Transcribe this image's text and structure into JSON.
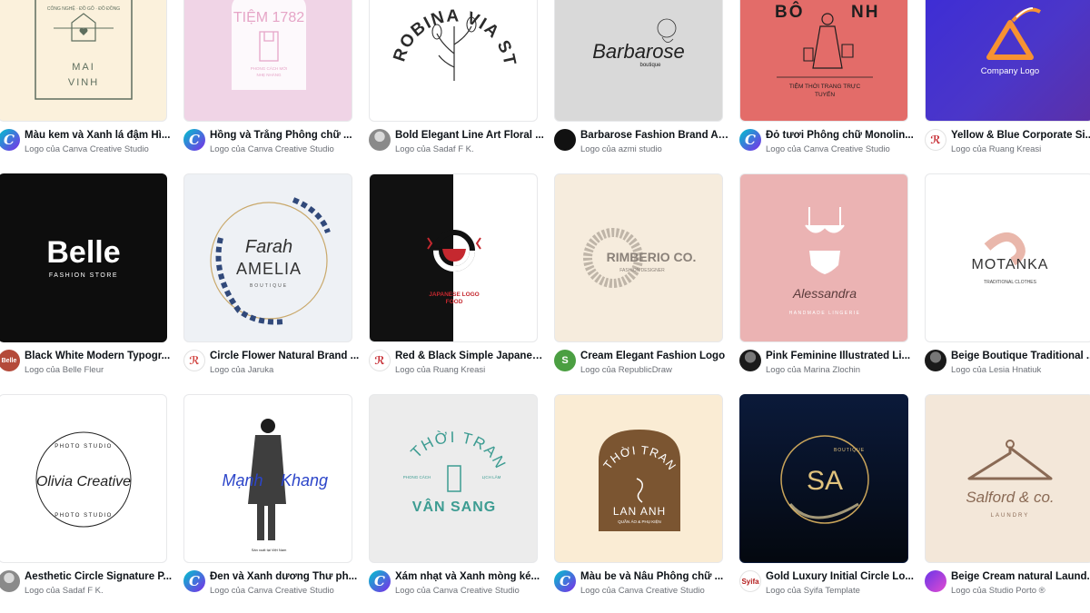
{
  "cards": [
    {
      "title": "Màu kem và Xanh lá đậm Hì...",
      "byline": "Logo của Canva Creative Studio",
      "logo_lines": [
        "CÔNG NGHỆ · ĐỒ GỖ · ĐỒ ĐỒNG",
        "MAI",
        "VINH"
      ]
    },
    {
      "title": "Hồng và Trắng Phông chữ ...",
      "byline": "Logo của Canva Creative Studio",
      "logo_lines": [
        "TIỆM 1782",
        "PHONG CÁCH MỚI",
        "NHẸ NHÀNG"
      ]
    },
    {
      "title": "Bold Elegant Line Art Floral ...",
      "byline": "Logo của Sadaf F K.",
      "logo_lines": [
        "ROBINA VIA STUDIO"
      ]
    },
    {
      "title": "Barbarose Fashion Brand Ar...",
      "byline": "Logo của azmi studio",
      "logo_lines": [
        "Barbarose",
        "boutique"
      ]
    },
    {
      "title": "Đỏ tươi Phông chữ Monolin...",
      "byline": "Logo của Canva Creative Studio",
      "logo_lines": [
        "BÔ",
        "NH",
        "TIỆM THỜI TRANG TRỰC",
        "TUYẾN"
      ]
    },
    {
      "title": "Yellow & Blue Corporate Si...",
      "byline": "Logo của Ruang Kreasi",
      "logo_lines": [
        "Company Logo"
      ]
    },
    {
      "title": "Black White Modern Typogr...",
      "byline": "Logo của Belle Fleur",
      "logo_lines": [
        "Belle",
        "FASHION STORE"
      ]
    },
    {
      "title": "Circle Flower Natural Brand ...",
      "byline": "Logo của Jaruka",
      "logo_lines": [
        "Farah",
        "AMELIA",
        "BOUTIQUE"
      ]
    },
    {
      "title": "Red & Black Simple Japanes...",
      "byline": "Logo của Ruang Kreasi",
      "logo_lines": [
        "JAPANESE LOGO",
        "FOOD"
      ]
    },
    {
      "title": "Cream Elegant Fashion Logo",
      "byline": "Logo của RepublicDraw",
      "logo_lines": [
        "RIMBERIO CO.",
        "FASHION DESIGNER"
      ]
    },
    {
      "title": "Pink Feminine Illustrated Li...",
      "byline": "Logo của Marina Zlochin",
      "logo_lines": [
        "Alessandra",
        "HANDMADE LINGERIE"
      ]
    },
    {
      "title": "Beige Boutique Traditional ...",
      "byline": "Logo của Lesia Hnatiuk",
      "logo_lines": [
        "MOTANKA",
        "TRADITIONAL CLOTHES"
      ]
    },
    {
      "title": "Aesthetic Circle Signature P...",
      "byline": "Logo của Sadaf F K.",
      "logo_lines": [
        "Olivia Creative",
        "PHOTO STUDIO"
      ]
    },
    {
      "title": "Đen và Xanh dương Thư ph...",
      "byline": "Logo của Canva Creative Studio",
      "logo_lines": [
        "Mạnh",
        "Khang",
        "Sản xuất tại Việt Nam"
      ]
    },
    {
      "title": "Xám nhạt và Xanh mòng ké...",
      "byline": "Logo của Canva Creative Studio",
      "logo_lines": [
        "THỜI TRANG",
        "VÂN SANG",
        "PHONG CÁCH",
        "LỊCH LÃM"
      ]
    },
    {
      "title": "Màu be và Nâu Phông chữ ...",
      "byline": "Logo của Canva Creative Studio",
      "logo_lines": [
        "THỜI TRANG",
        "LAN ANH",
        "QUẦN ÁO & PHỤ KIỆN"
      ]
    },
    {
      "title": "Gold Luxury Initial Circle Lo...",
      "byline": "Logo của Syifa Template",
      "logo_lines": [
        "SA",
        "BOUTIQUE"
      ]
    },
    {
      "title": "Beige Cream natural Laund...",
      "byline": "Logo của Studio Porto ®",
      "logo_lines": [
        "Salford & co.",
        "LAUNDRY"
      ]
    }
  ],
  "avatars": {
    "canva": "C",
    "belle": "Belle",
    "jaruka": "ℛ",
    "ruang": "ℛ",
    "republic": "S",
    "syifa": "Syifa"
  },
  "colors": {
    "canva_teal": "#00c4cc",
    "canva_purple": "#7d2ae8",
    "title_text": "#0e1318",
    "byline_text": "#6b6f76"
  }
}
